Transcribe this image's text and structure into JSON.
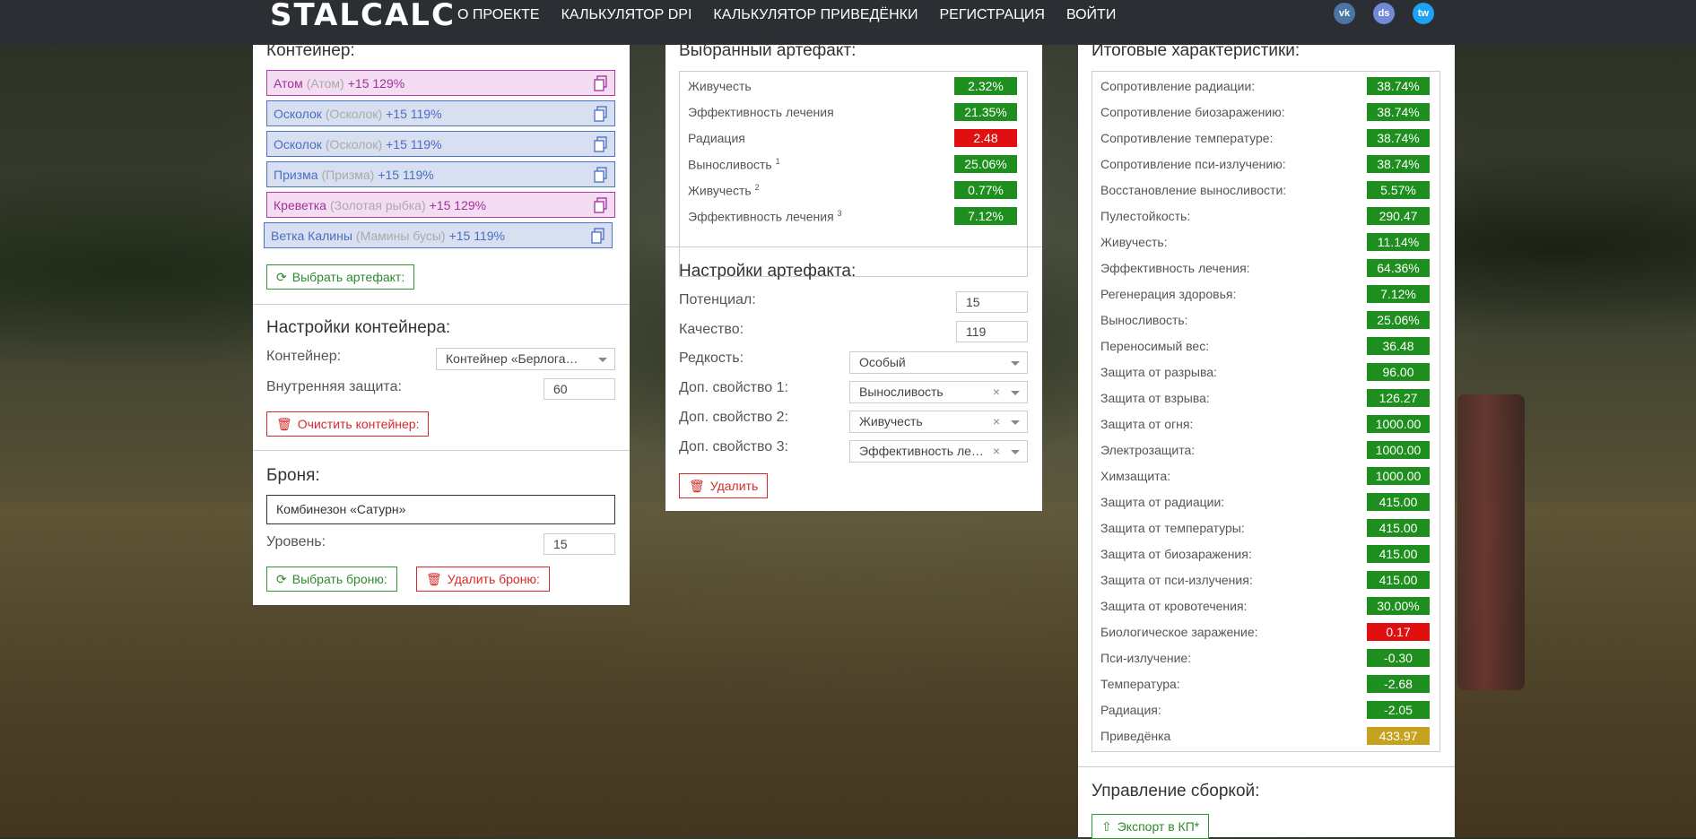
{
  "nav": {
    "logo": "STALCALC",
    "links": [
      "О ПРОЕКТЕ",
      "КАЛЬКУЛЯТОР DPI",
      "КАЛЬКУЛЯТОР ПРИВЕДЁНКИ",
      "РЕГИСТРАЦИЯ",
      "ВОЙТИ"
    ],
    "socials": [
      {
        "icon": "vk-icon",
        "text": "vk",
        "color": "#4c75a3"
      },
      {
        "icon": "discord-icon",
        "text": "ds",
        "color": "#7289da"
      },
      {
        "icon": "twitter-icon",
        "text": "tw",
        "color": "#1da1f2"
      }
    ]
  },
  "container": {
    "title": "Контейнер:",
    "items": [
      {
        "name": "Атом",
        "sub": "(Атом)",
        "value": "+15 129%",
        "color": "purple"
      },
      {
        "name": "Осколок",
        "sub": "(Осколок)",
        "value": "+15 119%",
        "color": "blue"
      },
      {
        "name": "Осколок",
        "sub": "(Осколок)",
        "value": "+15 119%",
        "color": "blue"
      },
      {
        "name": "Призма",
        "sub": "(Призма)",
        "value": "+15 119%",
        "color": "blue"
      },
      {
        "name": "Креветка",
        "sub": "(Золотая рыбка)",
        "value": "+15 129%",
        "color": "purple"
      },
      {
        "name": "Ветка Калины",
        "sub": "(Мамины бусы)",
        "value": "+15 119%",
        "color": "blue"
      }
    ],
    "select_button": "Выбрать артефакт:"
  },
  "container_settings": {
    "title": "Настройки контейнера:",
    "container_label": "Контейнер:",
    "container_value": "Контейнер «Берлога…",
    "protection_label": "Внутренняя защита:",
    "protection_value": "60",
    "clear_button": "Очистить контейнер:"
  },
  "armor": {
    "title": "Броня:",
    "value": "Комбинезон «Сатурн»",
    "level_label": "Уровень:",
    "level_value": "15",
    "select_button": "Выбрать броню:",
    "delete_button": "Удалить броню:"
  },
  "selected_artifact": {
    "title": "Выбранный артефакт:",
    "stats": [
      {
        "label": "Живучесть",
        "sup": "",
        "value": "2.32%",
        "color": "#1e8f1e"
      },
      {
        "label": "Эффективность лечения",
        "sup": "",
        "value": "21.35%",
        "color": "#1e8f1e"
      },
      {
        "label": "Радиация",
        "sup": "",
        "value": "2.48",
        "color": "#e01010"
      },
      {
        "label": "Выносливость",
        "sup": "1",
        "value": "25.06%",
        "color": "#1e8f1e"
      },
      {
        "label": "Живучесть",
        "sup": "2",
        "value": "0.77%",
        "color": "#1e8f1e"
      },
      {
        "label": "Эффективность лечения",
        "sup": "3",
        "value": "7.12%",
        "color": "#1e8f1e"
      }
    ]
  },
  "artifact_settings": {
    "title": "Настройки артефакта:",
    "potential_label": "Потенциал:",
    "potential_value": "15",
    "quality_label": "Качество:",
    "quality_value": "119",
    "rarity_label": "Редкость:",
    "rarity_value": "Особый",
    "prop1_label": "Доп. свойство 1:",
    "prop1_value": "Выносливость",
    "prop2_label": "Доп. свойство 2:",
    "prop2_value": "Живучесть",
    "prop3_label": "Доп. свойство 3:",
    "prop3_value": "Эффективность ле…",
    "delete_button": "Удалить"
  },
  "totals": {
    "title": "Итоговые характеристики:",
    "stats": [
      {
        "label": "Сопротивление радиации:",
        "value": "38.74%",
        "color": "#1e8f1e"
      },
      {
        "label": "Сопротивление биозаражению:",
        "value": "38.74%",
        "color": "#1e8f1e"
      },
      {
        "label": "Сопротивление температуре:",
        "value": "38.74%",
        "color": "#1e8f1e"
      },
      {
        "label": "Сопротивление пси-излучению:",
        "value": "38.74%",
        "color": "#1e8f1e"
      },
      {
        "label": "Восстановление выносливости:",
        "value": "5.57%",
        "color": "#1e8f1e"
      },
      {
        "label": "Пулестойкость:",
        "value": "290.47",
        "color": "#1e8f1e"
      },
      {
        "label": "Живучесть:",
        "value": "11.14%",
        "color": "#1e8f1e"
      },
      {
        "label": "Эффективность лечения:",
        "value": "64.36%",
        "color": "#1e8f1e"
      },
      {
        "label": "Регенерация здоровья:",
        "value": "7.12%",
        "color": "#1e8f1e"
      },
      {
        "label": "Выносливость:",
        "value": "25.06%",
        "color": "#1e8f1e"
      },
      {
        "label": "Переносимый вес:",
        "value": "36.48",
        "color": "#1e8f1e"
      },
      {
        "label": "Защита от разрыва:",
        "value": "96.00",
        "color": "#1e8f1e"
      },
      {
        "label": "Защита от взрыва:",
        "value": "126.27",
        "color": "#1e8f1e"
      },
      {
        "label": "Защита от огня:",
        "value": "1000.00",
        "color": "#1e8f1e"
      },
      {
        "label": "Электрозащита:",
        "value": "1000.00",
        "color": "#1e8f1e"
      },
      {
        "label": "Химзащита:",
        "value": "1000.00",
        "color": "#1e8f1e"
      },
      {
        "label": "Защита от радиации:",
        "value": "415.00",
        "color": "#1e8f1e"
      },
      {
        "label": "Защита от температуры:",
        "value": "415.00",
        "color": "#1e8f1e"
      },
      {
        "label": "Защита от биозаражения:",
        "value": "415.00",
        "color": "#1e8f1e"
      },
      {
        "label": "Защита от пси-излучения:",
        "value": "415.00",
        "color": "#1e8f1e"
      },
      {
        "label": "Защита от кровотечения:",
        "value": "30.00%",
        "color": "#1e8f1e"
      },
      {
        "label": "Биологическое заражение:",
        "value": "0.17",
        "color": "#e01010"
      },
      {
        "label": "Пси-излучение:",
        "value": "-0.30",
        "color": "#1e8f1e"
      },
      {
        "label": "Температура:",
        "value": "-2.68",
        "color": "#1e8f1e"
      },
      {
        "label": "Радиация:",
        "value": "-2.05",
        "color": "#1e8f1e"
      },
      {
        "label": "Приведёнка",
        "value": "433.97",
        "color": "#c6a21e"
      }
    ]
  },
  "build": {
    "title": "Управление сборкой:",
    "export_button": "Экспорт в КП*"
  }
}
